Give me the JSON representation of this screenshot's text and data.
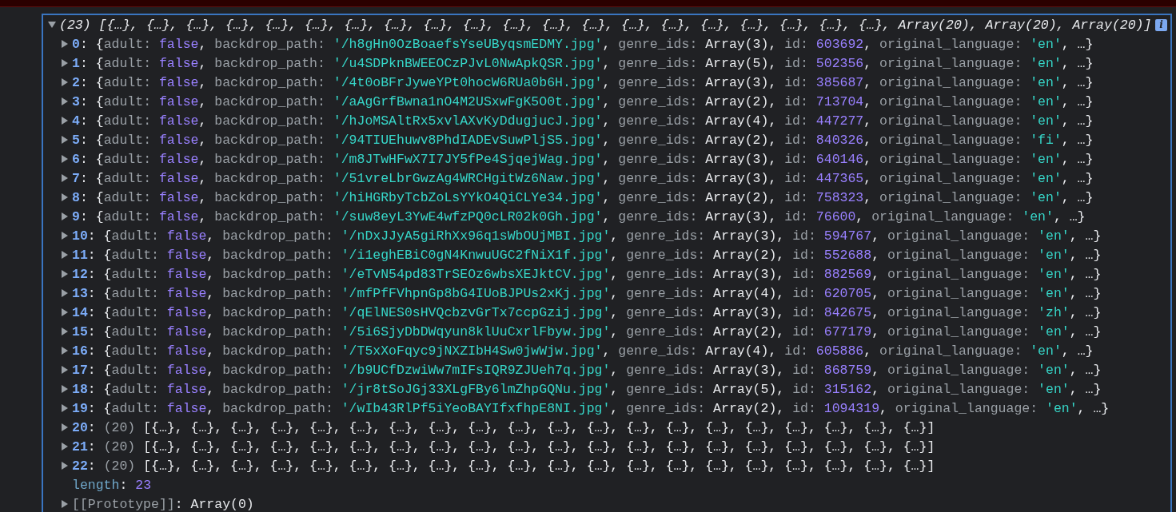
{
  "console": {
    "summary": {
      "expanded": true,
      "tokens": [
        {
          "kind": "p",
          "text": "(23) [{…}, {…}, {…}, {…}, {…}, {…}, {…}, {…}, {…}, {…}, {…}, {…}, {…}, {…}, {…}, {…}, {…}, {…}, {…}, {…}, Array(20), Array(20), Array(20)]"
        }
      ]
    },
    "info_badge": "i",
    "entries": [
      {
        "kind": "object",
        "expanded": false,
        "tokens": [
          {
            "kind": "idx",
            "text": "0"
          },
          {
            "kind": "p",
            "text": ": {"
          },
          {
            "kind": "key",
            "text": "adult: "
          },
          {
            "kind": "bool",
            "text": "false"
          },
          {
            "kind": "p",
            "text": ", "
          },
          {
            "kind": "key",
            "text": "backdrop_path: "
          },
          {
            "kind": "str",
            "text": "'/h8gHn0OzBoaefsYseUByqsmEDMY.jpg'"
          },
          {
            "kind": "p",
            "text": ", "
          },
          {
            "kind": "key",
            "text": "genre_ids: "
          },
          {
            "kind": "p",
            "text": "Array(3)"
          },
          {
            "kind": "p",
            "text": ", "
          },
          {
            "kind": "key",
            "text": "id: "
          },
          {
            "kind": "num",
            "text": "603692"
          },
          {
            "kind": "p",
            "text": ", "
          },
          {
            "kind": "key",
            "text": "original_language: "
          },
          {
            "kind": "str",
            "text": "'en'"
          },
          {
            "kind": "p",
            "text": ", …}"
          }
        ]
      },
      {
        "kind": "object",
        "expanded": false,
        "tokens": [
          {
            "kind": "idx",
            "text": "1"
          },
          {
            "kind": "p",
            "text": ": {"
          },
          {
            "kind": "key",
            "text": "adult: "
          },
          {
            "kind": "bool",
            "text": "false"
          },
          {
            "kind": "p",
            "text": ", "
          },
          {
            "kind": "key",
            "text": "backdrop_path: "
          },
          {
            "kind": "str",
            "text": "'/u4SDPknBWEEOCzPJvL0NwApkQSR.jpg'"
          },
          {
            "kind": "p",
            "text": ", "
          },
          {
            "kind": "key",
            "text": "genre_ids: "
          },
          {
            "kind": "p",
            "text": "Array(5)"
          },
          {
            "kind": "p",
            "text": ", "
          },
          {
            "kind": "key",
            "text": "id: "
          },
          {
            "kind": "num",
            "text": "502356"
          },
          {
            "kind": "p",
            "text": ", "
          },
          {
            "kind": "key",
            "text": "original_language: "
          },
          {
            "kind": "str",
            "text": "'en'"
          },
          {
            "kind": "p",
            "text": ", …}"
          }
        ]
      },
      {
        "kind": "object",
        "expanded": false,
        "tokens": [
          {
            "kind": "idx",
            "text": "2"
          },
          {
            "kind": "p",
            "text": ": {"
          },
          {
            "kind": "key",
            "text": "adult: "
          },
          {
            "kind": "bool",
            "text": "false"
          },
          {
            "kind": "p",
            "text": ", "
          },
          {
            "kind": "key",
            "text": "backdrop_path: "
          },
          {
            "kind": "str",
            "text": "'/4t0oBFrJyweYPt0hocW6RUa0b6H.jpg'"
          },
          {
            "kind": "p",
            "text": ", "
          },
          {
            "kind": "key",
            "text": "genre_ids: "
          },
          {
            "kind": "p",
            "text": "Array(3)"
          },
          {
            "kind": "p",
            "text": ", "
          },
          {
            "kind": "key",
            "text": "id: "
          },
          {
            "kind": "num",
            "text": "385687"
          },
          {
            "kind": "p",
            "text": ", "
          },
          {
            "kind": "key",
            "text": "original_language: "
          },
          {
            "kind": "str",
            "text": "'en'"
          },
          {
            "kind": "p",
            "text": ", …}"
          }
        ]
      },
      {
        "kind": "object",
        "expanded": false,
        "tokens": [
          {
            "kind": "idx",
            "text": "3"
          },
          {
            "kind": "p",
            "text": ": {"
          },
          {
            "kind": "key",
            "text": "adult: "
          },
          {
            "kind": "bool",
            "text": "false"
          },
          {
            "kind": "p",
            "text": ", "
          },
          {
            "kind": "key",
            "text": "backdrop_path: "
          },
          {
            "kind": "str",
            "text": "'/aAgGrfBwna1nO4M2USxwFgK5O0t.jpg'"
          },
          {
            "kind": "p",
            "text": ", "
          },
          {
            "kind": "key",
            "text": "genre_ids: "
          },
          {
            "kind": "p",
            "text": "Array(2)"
          },
          {
            "kind": "p",
            "text": ", "
          },
          {
            "kind": "key",
            "text": "id: "
          },
          {
            "kind": "num",
            "text": "713704"
          },
          {
            "kind": "p",
            "text": ", "
          },
          {
            "kind": "key",
            "text": "original_language: "
          },
          {
            "kind": "str",
            "text": "'en'"
          },
          {
            "kind": "p",
            "text": ", …}"
          }
        ]
      },
      {
        "kind": "object",
        "expanded": false,
        "tokens": [
          {
            "kind": "idx",
            "text": "4"
          },
          {
            "kind": "p",
            "text": ": {"
          },
          {
            "kind": "key",
            "text": "adult: "
          },
          {
            "kind": "bool",
            "text": "false"
          },
          {
            "kind": "p",
            "text": ", "
          },
          {
            "kind": "key",
            "text": "backdrop_path: "
          },
          {
            "kind": "str",
            "text": "'/hJoMSAltRx5xvlAXvKyDdugjucJ.jpg'"
          },
          {
            "kind": "p",
            "text": ", "
          },
          {
            "kind": "key",
            "text": "genre_ids: "
          },
          {
            "kind": "p",
            "text": "Array(4)"
          },
          {
            "kind": "p",
            "text": ", "
          },
          {
            "kind": "key",
            "text": "id: "
          },
          {
            "kind": "num",
            "text": "447277"
          },
          {
            "kind": "p",
            "text": ", "
          },
          {
            "kind": "key",
            "text": "original_language: "
          },
          {
            "kind": "str",
            "text": "'en'"
          },
          {
            "kind": "p",
            "text": ", …}"
          }
        ]
      },
      {
        "kind": "object",
        "expanded": false,
        "tokens": [
          {
            "kind": "idx",
            "text": "5"
          },
          {
            "kind": "p",
            "text": ": {"
          },
          {
            "kind": "key",
            "text": "adult: "
          },
          {
            "kind": "bool",
            "text": "false"
          },
          {
            "kind": "p",
            "text": ", "
          },
          {
            "kind": "key",
            "text": "backdrop_path: "
          },
          {
            "kind": "str",
            "text": "'/94TIUEhuwv8PhdIADEvSuwPljS5.jpg'"
          },
          {
            "kind": "p",
            "text": ", "
          },
          {
            "kind": "key",
            "text": "genre_ids: "
          },
          {
            "kind": "p",
            "text": "Array(2)"
          },
          {
            "kind": "p",
            "text": ", "
          },
          {
            "kind": "key",
            "text": "id: "
          },
          {
            "kind": "num",
            "text": "840326"
          },
          {
            "kind": "p",
            "text": ", "
          },
          {
            "kind": "key",
            "text": "original_language: "
          },
          {
            "kind": "str",
            "text": "'fi'"
          },
          {
            "kind": "p",
            "text": ", …}"
          }
        ]
      },
      {
        "kind": "object",
        "expanded": false,
        "tokens": [
          {
            "kind": "idx",
            "text": "6"
          },
          {
            "kind": "p",
            "text": ": {"
          },
          {
            "kind": "key",
            "text": "adult: "
          },
          {
            "kind": "bool",
            "text": "false"
          },
          {
            "kind": "p",
            "text": ", "
          },
          {
            "kind": "key",
            "text": "backdrop_path: "
          },
          {
            "kind": "str",
            "text": "'/m8JTwHFwX7I7JY5fPe4SjqejWag.jpg'"
          },
          {
            "kind": "p",
            "text": ", "
          },
          {
            "kind": "key",
            "text": "genre_ids: "
          },
          {
            "kind": "p",
            "text": "Array(3)"
          },
          {
            "kind": "p",
            "text": ", "
          },
          {
            "kind": "key",
            "text": "id: "
          },
          {
            "kind": "num",
            "text": "640146"
          },
          {
            "kind": "p",
            "text": ", "
          },
          {
            "kind": "key",
            "text": "original_language: "
          },
          {
            "kind": "str",
            "text": "'en'"
          },
          {
            "kind": "p",
            "text": ", …}"
          }
        ]
      },
      {
        "kind": "object",
        "expanded": false,
        "tokens": [
          {
            "kind": "idx",
            "text": "7"
          },
          {
            "kind": "p",
            "text": ": {"
          },
          {
            "kind": "key",
            "text": "adult: "
          },
          {
            "kind": "bool",
            "text": "false"
          },
          {
            "kind": "p",
            "text": ", "
          },
          {
            "kind": "key",
            "text": "backdrop_path: "
          },
          {
            "kind": "str",
            "text": "'/51vreLbrGwzAg4WRCHgitWz6Naw.jpg'"
          },
          {
            "kind": "p",
            "text": ", "
          },
          {
            "kind": "key",
            "text": "genre_ids: "
          },
          {
            "kind": "p",
            "text": "Array(3)"
          },
          {
            "kind": "p",
            "text": ", "
          },
          {
            "kind": "key",
            "text": "id: "
          },
          {
            "kind": "num",
            "text": "447365"
          },
          {
            "kind": "p",
            "text": ", "
          },
          {
            "kind": "key",
            "text": "original_language: "
          },
          {
            "kind": "str",
            "text": "'en'"
          },
          {
            "kind": "p",
            "text": ", …}"
          }
        ]
      },
      {
        "kind": "object",
        "expanded": false,
        "tokens": [
          {
            "kind": "idx",
            "text": "8"
          },
          {
            "kind": "p",
            "text": ": {"
          },
          {
            "kind": "key",
            "text": "adult: "
          },
          {
            "kind": "bool",
            "text": "false"
          },
          {
            "kind": "p",
            "text": ", "
          },
          {
            "kind": "key",
            "text": "backdrop_path: "
          },
          {
            "kind": "str",
            "text": "'/hiHGRbyTcbZoLsYYkO4QiCLYe34.jpg'"
          },
          {
            "kind": "p",
            "text": ", "
          },
          {
            "kind": "key",
            "text": "genre_ids: "
          },
          {
            "kind": "p",
            "text": "Array(2)"
          },
          {
            "kind": "p",
            "text": ", "
          },
          {
            "kind": "key",
            "text": "id: "
          },
          {
            "kind": "num",
            "text": "758323"
          },
          {
            "kind": "p",
            "text": ", "
          },
          {
            "kind": "key",
            "text": "original_language: "
          },
          {
            "kind": "str",
            "text": "'en'"
          },
          {
            "kind": "p",
            "text": ", …}"
          }
        ]
      },
      {
        "kind": "object",
        "expanded": false,
        "tokens": [
          {
            "kind": "idx",
            "text": "9"
          },
          {
            "kind": "p",
            "text": ": {"
          },
          {
            "kind": "key",
            "text": "adult: "
          },
          {
            "kind": "bool",
            "text": "false"
          },
          {
            "kind": "p",
            "text": ", "
          },
          {
            "kind": "key",
            "text": "backdrop_path: "
          },
          {
            "kind": "str",
            "text": "'/suw8eyL3YwE4wfzPQ0cLR02k0Gh.jpg'"
          },
          {
            "kind": "p",
            "text": ", "
          },
          {
            "kind": "key",
            "text": "genre_ids: "
          },
          {
            "kind": "p",
            "text": "Array(3)"
          },
          {
            "kind": "p",
            "text": ", "
          },
          {
            "kind": "key",
            "text": "id: "
          },
          {
            "kind": "num",
            "text": "76600"
          },
          {
            "kind": "p",
            "text": ", "
          },
          {
            "kind": "key",
            "text": "original_language: "
          },
          {
            "kind": "str",
            "text": "'en'"
          },
          {
            "kind": "p",
            "text": ", …}"
          }
        ]
      },
      {
        "kind": "object",
        "expanded": false,
        "tokens": [
          {
            "kind": "idx",
            "text": "10"
          },
          {
            "kind": "p",
            "text": ": {"
          },
          {
            "kind": "key",
            "text": "adult: "
          },
          {
            "kind": "bool",
            "text": "false"
          },
          {
            "kind": "p",
            "text": ", "
          },
          {
            "kind": "key",
            "text": "backdrop_path: "
          },
          {
            "kind": "str",
            "text": "'/nDxJJyA5giRhXx96q1sWbOUjMBI.jpg'"
          },
          {
            "kind": "p",
            "text": ", "
          },
          {
            "kind": "key",
            "text": "genre_ids: "
          },
          {
            "kind": "p",
            "text": "Array(3)"
          },
          {
            "kind": "p",
            "text": ", "
          },
          {
            "kind": "key",
            "text": "id: "
          },
          {
            "kind": "num",
            "text": "594767"
          },
          {
            "kind": "p",
            "text": ", "
          },
          {
            "kind": "key",
            "text": "original_language: "
          },
          {
            "kind": "str",
            "text": "'en'"
          },
          {
            "kind": "p",
            "text": ", …}"
          }
        ]
      },
      {
        "kind": "object",
        "expanded": false,
        "tokens": [
          {
            "kind": "idx",
            "text": "11"
          },
          {
            "kind": "p",
            "text": ": {"
          },
          {
            "kind": "key",
            "text": "adult: "
          },
          {
            "kind": "bool",
            "text": "false"
          },
          {
            "kind": "p",
            "text": ", "
          },
          {
            "kind": "key",
            "text": "backdrop_path: "
          },
          {
            "kind": "str",
            "text": "'/i1eghEBiC0gN4KnwuUGC2fNiX1f.jpg'"
          },
          {
            "kind": "p",
            "text": ", "
          },
          {
            "kind": "key",
            "text": "genre_ids: "
          },
          {
            "kind": "p",
            "text": "Array(2)"
          },
          {
            "kind": "p",
            "text": ", "
          },
          {
            "kind": "key",
            "text": "id: "
          },
          {
            "kind": "num",
            "text": "552688"
          },
          {
            "kind": "p",
            "text": ", "
          },
          {
            "kind": "key",
            "text": "original_language: "
          },
          {
            "kind": "str",
            "text": "'en'"
          },
          {
            "kind": "p",
            "text": ", …}"
          }
        ]
      },
      {
        "kind": "object",
        "expanded": false,
        "tokens": [
          {
            "kind": "idx",
            "text": "12"
          },
          {
            "kind": "p",
            "text": ": {"
          },
          {
            "kind": "key",
            "text": "adult: "
          },
          {
            "kind": "bool",
            "text": "false"
          },
          {
            "kind": "p",
            "text": ", "
          },
          {
            "kind": "key",
            "text": "backdrop_path: "
          },
          {
            "kind": "str",
            "text": "'/eTvN54pd83TrSEOz6wbsXEJktCV.jpg'"
          },
          {
            "kind": "p",
            "text": ", "
          },
          {
            "kind": "key",
            "text": "genre_ids: "
          },
          {
            "kind": "p",
            "text": "Array(3)"
          },
          {
            "kind": "p",
            "text": ", "
          },
          {
            "kind": "key",
            "text": "id: "
          },
          {
            "kind": "num",
            "text": "882569"
          },
          {
            "kind": "p",
            "text": ", "
          },
          {
            "kind": "key",
            "text": "original_language: "
          },
          {
            "kind": "str",
            "text": "'en'"
          },
          {
            "kind": "p",
            "text": ", …}"
          }
        ]
      },
      {
        "kind": "object",
        "expanded": false,
        "tokens": [
          {
            "kind": "idx",
            "text": "13"
          },
          {
            "kind": "p",
            "text": ": {"
          },
          {
            "kind": "key",
            "text": "adult: "
          },
          {
            "kind": "bool",
            "text": "false"
          },
          {
            "kind": "p",
            "text": ", "
          },
          {
            "kind": "key",
            "text": "backdrop_path: "
          },
          {
            "kind": "str",
            "text": "'/mfPfFVhpnGp8bG4IUoBJPUs2xKj.jpg'"
          },
          {
            "kind": "p",
            "text": ", "
          },
          {
            "kind": "key",
            "text": "genre_ids: "
          },
          {
            "kind": "p",
            "text": "Array(4)"
          },
          {
            "kind": "p",
            "text": ", "
          },
          {
            "kind": "key",
            "text": "id: "
          },
          {
            "kind": "num",
            "text": "620705"
          },
          {
            "kind": "p",
            "text": ", "
          },
          {
            "kind": "key",
            "text": "original_language: "
          },
          {
            "kind": "str",
            "text": "'en'"
          },
          {
            "kind": "p",
            "text": ", …}"
          }
        ]
      },
      {
        "kind": "object",
        "expanded": false,
        "tokens": [
          {
            "kind": "idx",
            "text": "14"
          },
          {
            "kind": "p",
            "text": ": {"
          },
          {
            "kind": "key",
            "text": "adult: "
          },
          {
            "kind": "bool",
            "text": "false"
          },
          {
            "kind": "p",
            "text": ", "
          },
          {
            "kind": "key",
            "text": "backdrop_path: "
          },
          {
            "kind": "str",
            "text": "'/qElNES0sHVQcbzvGrTx7ccpGzij.jpg'"
          },
          {
            "kind": "p",
            "text": ", "
          },
          {
            "kind": "key",
            "text": "genre_ids: "
          },
          {
            "kind": "p",
            "text": "Array(3)"
          },
          {
            "kind": "p",
            "text": ", "
          },
          {
            "kind": "key",
            "text": "id: "
          },
          {
            "kind": "num",
            "text": "842675"
          },
          {
            "kind": "p",
            "text": ", "
          },
          {
            "kind": "key",
            "text": "original_language: "
          },
          {
            "kind": "str",
            "text": "'zh'"
          },
          {
            "kind": "p",
            "text": ", …}"
          }
        ]
      },
      {
        "kind": "object",
        "expanded": false,
        "tokens": [
          {
            "kind": "idx",
            "text": "15"
          },
          {
            "kind": "p",
            "text": ": {"
          },
          {
            "kind": "key",
            "text": "adult: "
          },
          {
            "kind": "bool",
            "text": "false"
          },
          {
            "kind": "p",
            "text": ", "
          },
          {
            "kind": "key",
            "text": "backdrop_path: "
          },
          {
            "kind": "str",
            "text": "'/5i6SjyDbDWqyun8klUuCxrlFbyw.jpg'"
          },
          {
            "kind": "p",
            "text": ", "
          },
          {
            "kind": "key",
            "text": "genre_ids: "
          },
          {
            "kind": "p",
            "text": "Array(2)"
          },
          {
            "kind": "p",
            "text": ", "
          },
          {
            "kind": "key",
            "text": "id: "
          },
          {
            "kind": "num",
            "text": "677179"
          },
          {
            "kind": "p",
            "text": ", "
          },
          {
            "kind": "key",
            "text": "original_language: "
          },
          {
            "kind": "str",
            "text": "'en'"
          },
          {
            "kind": "p",
            "text": ", …}"
          }
        ]
      },
      {
        "kind": "object",
        "expanded": false,
        "tokens": [
          {
            "kind": "idx",
            "text": "16"
          },
          {
            "kind": "p",
            "text": ": {"
          },
          {
            "kind": "key",
            "text": "adult: "
          },
          {
            "kind": "bool",
            "text": "false"
          },
          {
            "kind": "p",
            "text": ", "
          },
          {
            "kind": "key",
            "text": "backdrop_path: "
          },
          {
            "kind": "str",
            "text": "'/T5xXoFqyc9jNXZIbH4Sw0jwWjw.jpg'"
          },
          {
            "kind": "p",
            "text": ", "
          },
          {
            "kind": "key",
            "text": "genre_ids: "
          },
          {
            "kind": "p",
            "text": "Array(4)"
          },
          {
            "kind": "p",
            "text": ", "
          },
          {
            "kind": "key",
            "text": "id: "
          },
          {
            "kind": "num",
            "text": "605886"
          },
          {
            "kind": "p",
            "text": ", "
          },
          {
            "kind": "key",
            "text": "original_language: "
          },
          {
            "kind": "str",
            "text": "'en'"
          },
          {
            "kind": "p",
            "text": ", …}"
          }
        ]
      },
      {
        "kind": "object",
        "expanded": false,
        "tokens": [
          {
            "kind": "idx",
            "text": "17"
          },
          {
            "kind": "p",
            "text": ": {"
          },
          {
            "kind": "key",
            "text": "adult: "
          },
          {
            "kind": "bool",
            "text": "false"
          },
          {
            "kind": "p",
            "text": ", "
          },
          {
            "kind": "key",
            "text": "backdrop_path: "
          },
          {
            "kind": "str",
            "text": "'/b9UCfDzwiWw7mIFsIQR9ZJUeh7q.jpg'"
          },
          {
            "kind": "p",
            "text": ", "
          },
          {
            "kind": "key",
            "text": "genre_ids: "
          },
          {
            "kind": "p",
            "text": "Array(3)"
          },
          {
            "kind": "p",
            "text": ", "
          },
          {
            "kind": "key",
            "text": "id: "
          },
          {
            "kind": "num",
            "text": "868759"
          },
          {
            "kind": "p",
            "text": ", "
          },
          {
            "kind": "key",
            "text": "original_language: "
          },
          {
            "kind": "str",
            "text": "'en'"
          },
          {
            "kind": "p",
            "text": ", …}"
          }
        ]
      },
      {
        "kind": "object",
        "expanded": false,
        "tokens": [
          {
            "kind": "idx",
            "text": "18"
          },
          {
            "kind": "p",
            "text": ": {"
          },
          {
            "kind": "key",
            "text": "adult: "
          },
          {
            "kind": "bool",
            "text": "false"
          },
          {
            "kind": "p",
            "text": ", "
          },
          {
            "kind": "key",
            "text": "backdrop_path: "
          },
          {
            "kind": "str",
            "text": "'/jr8tSoJGj33XLgFBy6lmZhpGQNu.jpg'"
          },
          {
            "kind": "p",
            "text": ", "
          },
          {
            "kind": "key",
            "text": "genre_ids: "
          },
          {
            "kind": "p",
            "text": "Array(5)"
          },
          {
            "kind": "p",
            "text": ", "
          },
          {
            "kind": "key",
            "text": "id: "
          },
          {
            "kind": "num",
            "text": "315162"
          },
          {
            "kind": "p",
            "text": ", "
          },
          {
            "kind": "key",
            "text": "original_language: "
          },
          {
            "kind": "str",
            "text": "'en'"
          },
          {
            "kind": "p",
            "text": ", …}"
          }
        ]
      },
      {
        "kind": "object",
        "expanded": false,
        "tokens": [
          {
            "kind": "idx",
            "text": "19"
          },
          {
            "kind": "p",
            "text": ": {"
          },
          {
            "kind": "key",
            "text": "adult: "
          },
          {
            "kind": "bool",
            "text": "false"
          },
          {
            "kind": "p",
            "text": ", "
          },
          {
            "kind": "key",
            "text": "backdrop_path: "
          },
          {
            "kind": "str",
            "text": "'/wIb43RlPf5iYeoBAYIfxfhpE8NI.jpg'"
          },
          {
            "kind": "p",
            "text": ", "
          },
          {
            "kind": "key",
            "text": "genre_ids: "
          },
          {
            "kind": "p",
            "text": "Array(2)"
          },
          {
            "kind": "p",
            "text": ", "
          },
          {
            "kind": "key",
            "text": "id: "
          },
          {
            "kind": "num",
            "text": "1094319"
          },
          {
            "kind": "p",
            "text": ", "
          },
          {
            "kind": "key",
            "text": "original_language: "
          },
          {
            "kind": "str",
            "text": "'en'"
          },
          {
            "kind": "p",
            "text": ", …}"
          }
        ]
      },
      {
        "kind": "array",
        "expanded": false,
        "tokens": [
          {
            "kind": "idx",
            "text": "20"
          },
          {
            "kind": "p",
            "text": ": "
          },
          {
            "kind": "key",
            "text": "(20) "
          },
          {
            "kind": "p",
            "text": "[{…}, {…}, {…}, {…}, {…}, {…}, {…}, {…}, {…}, {…}, {…}, {…}, {…}, {…}, {…}, {…}, {…}, {…}, {…}, {…}]"
          }
        ]
      },
      {
        "kind": "array",
        "expanded": false,
        "tokens": [
          {
            "kind": "idx",
            "text": "21"
          },
          {
            "kind": "p",
            "text": ": "
          },
          {
            "kind": "key",
            "text": "(20) "
          },
          {
            "kind": "p",
            "text": "[{…}, {…}, {…}, {…}, {…}, {…}, {…}, {…}, {…}, {…}, {…}, {…}, {…}, {…}, {…}, {…}, {…}, {…}, {…}, {…}]"
          }
        ]
      },
      {
        "kind": "array",
        "expanded": false,
        "tokens": [
          {
            "kind": "idx",
            "text": "22"
          },
          {
            "kind": "p",
            "text": ": "
          },
          {
            "kind": "key",
            "text": "(20) "
          },
          {
            "kind": "p",
            "text": "[{…}, {…}, {…}, {…}, {…}, {…}, {…}, {…}, {…}, {…}, {…}, {…}, {…}, {…}, {…}, {…}, {…}, {…}, {…}, {…}]"
          }
        ]
      },
      {
        "kind": "length",
        "tokens": [
          {
            "kind": "prop",
            "text": "length"
          },
          {
            "kind": "p",
            "text": ": "
          },
          {
            "kind": "num",
            "text": "23"
          }
        ]
      },
      {
        "kind": "prototype",
        "expanded": false,
        "tokens": [
          {
            "kind": "key",
            "text": "[[Prototype]]"
          },
          {
            "kind": "p",
            "text": ": Array(0)"
          }
        ]
      }
    ]
  }
}
